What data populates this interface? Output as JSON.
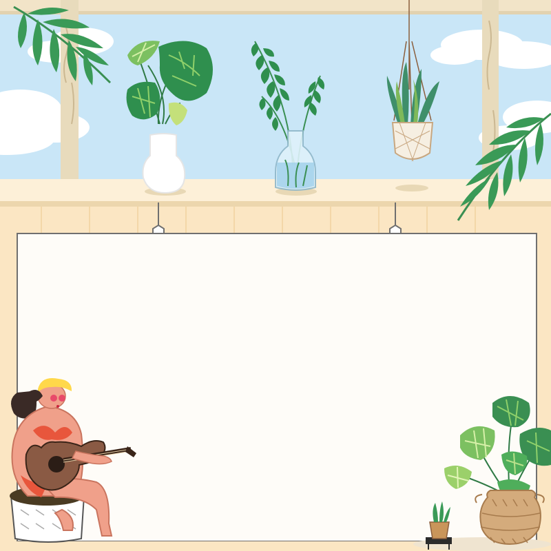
{
  "scene": {
    "background_color": "#fbe6c3",
    "sky_color": "#c9e6f7",
    "board_color": "#fefcf8",
    "board_border_color": "#6f6f6f",
    "window_frame_color": "#e9dcc0",
    "shelf_color": "#fdf0d8",
    "leaf_colors": [
      "#2f8f4e",
      "#4fae5b",
      "#8fd06a"
    ],
    "icons": [
      "palm-leaf-icon",
      "monstera-vase-icon",
      "fern-jar-icon",
      "hanging-snake-plant-icon",
      "guitar-player-icon",
      "monstera-basket-icon",
      "small-succulent-icon"
    ]
  }
}
